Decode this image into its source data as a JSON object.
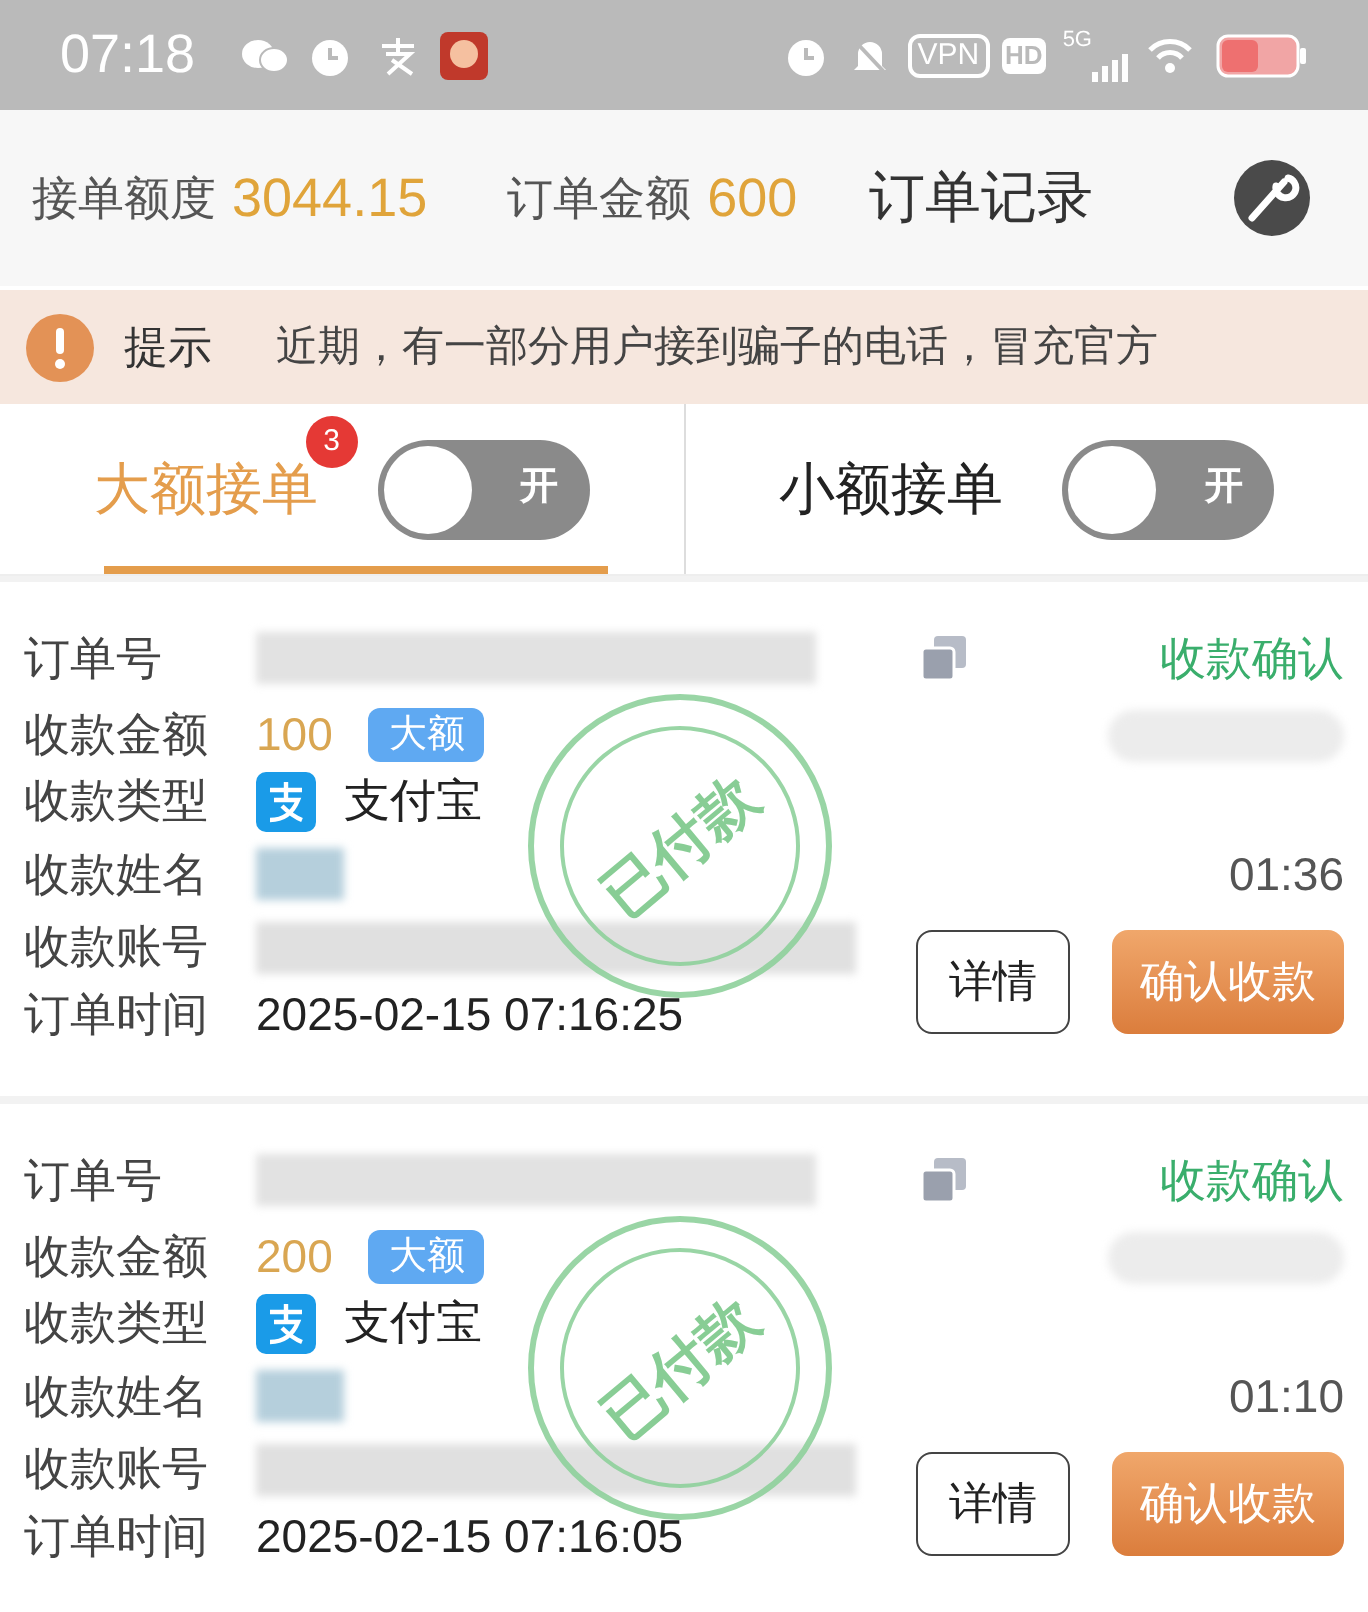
{
  "status_bar": {
    "time": "07:18",
    "vpn": "VPN",
    "hd": "HD",
    "network": "5G"
  },
  "header": {
    "quota_label": "接单额度",
    "quota_value": "3044.15",
    "amount_label": "订单金额",
    "amount_value": "600",
    "records_link": "订单记录"
  },
  "notice": {
    "label": "提示",
    "text": "近期，有一部分用户接到骗子的电话，冒充官方"
  },
  "tabs": [
    {
      "label": "大额接单",
      "selected": true,
      "badge": "3",
      "switch_label": "开",
      "on": false
    },
    {
      "label": "小额接单",
      "selected": false,
      "switch_label": "开",
      "on": false
    }
  ],
  "orders": [
    {
      "order_no_label": "订单号",
      "status": "收款确认",
      "amount_label": "收款金额",
      "amount": "100",
      "size_tag": "大额",
      "type_label": "收款类型",
      "type_value": "支付宝",
      "name_label": "收款姓名",
      "countdown": "01:36",
      "account_label": "收款账号",
      "time_label": "订单时间",
      "time": "2025-02-15 07:16:25",
      "detail_button": "详情",
      "confirm_button": "确认收款",
      "stamp": "已付款"
    },
    {
      "order_no_label": "订单号",
      "status": "收款确认",
      "amount_label": "收款金额",
      "amount": "200",
      "size_tag": "大额",
      "type_label": "收款类型",
      "type_value": "支付宝",
      "name_label": "收款姓名",
      "countdown": "01:10",
      "account_label": "收款账号",
      "time_label": "订单时间",
      "time": "2025-02-15 07:16:05",
      "detail_button": "详情",
      "confirm_button": "确认收款",
      "stamp": "已付款"
    }
  ]
}
